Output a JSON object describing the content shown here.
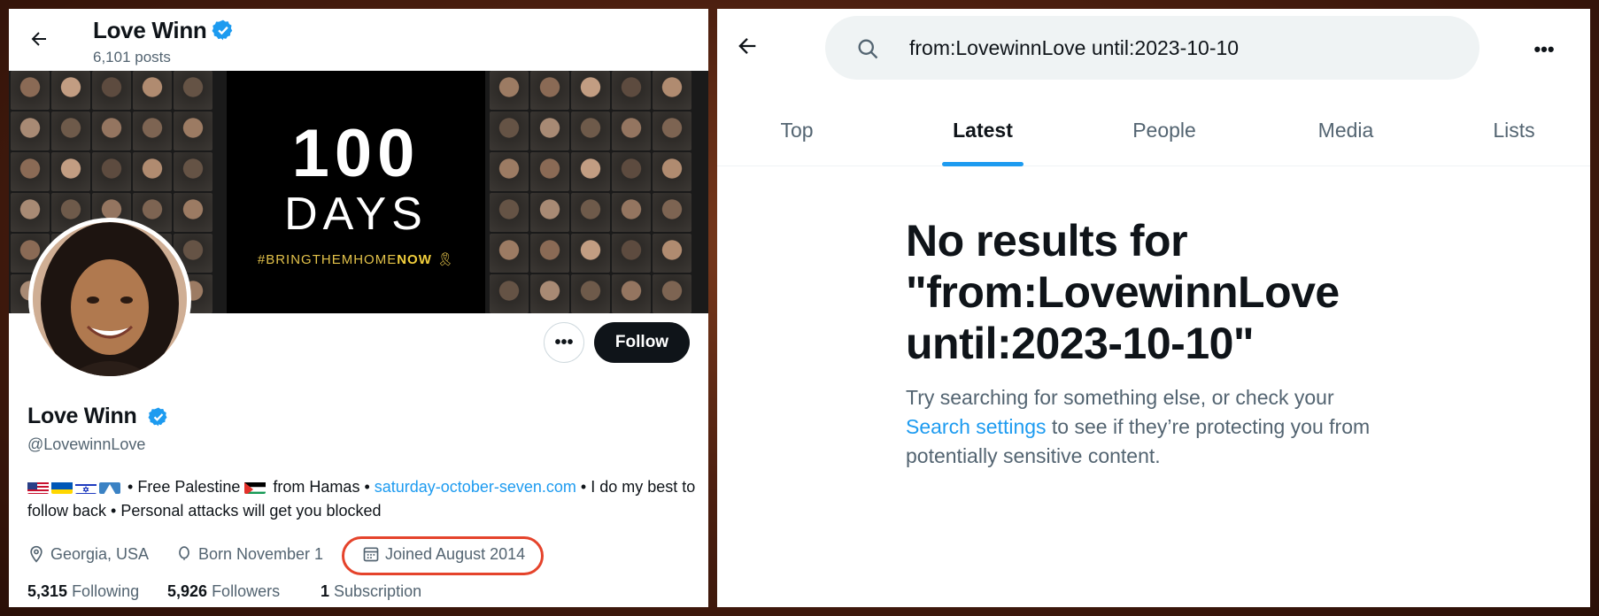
{
  "left": {
    "header": {
      "name": "Love Winn",
      "posts": "6,101 posts"
    },
    "banner": {
      "big_number": "100",
      "word": "DAYS",
      "hashtag_prefix": "#BRINGTHEMHOME",
      "hashtag_suffix": "NOW",
      "ribbon": "🎗"
    },
    "actions": {
      "more": "•••",
      "follow": "Follow"
    },
    "profile": {
      "display_name": "Love Winn",
      "handle": "@LovewinnLove",
      "bio_part1": "• Free Palestine",
      "bio_part2": "from Hamas •",
      "bio_link": "saturday-october-seven.com",
      "bio_part3": "• I do my best to follow back • Personal attacks will get you blocked"
    },
    "meta": {
      "location": "Georgia, USA",
      "born": "Born November 1",
      "joined": "Joined August 2014"
    },
    "stats": {
      "following_count": "5,315",
      "following_label": "Following",
      "followers_count": "5,926",
      "followers_label": "Followers",
      "subscription_count": "1",
      "subscription_label": "Subscription"
    }
  },
  "right": {
    "search": {
      "query": "from:LovewinnLove until:2023-10-10"
    },
    "more": "•••",
    "tabs": [
      {
        "label": "Top"
      },
      {
        "label": "Latest"
      },
      {
        "label": "People"
      },
      {
        "label": "Media"
      },
      {
        "label": "Lists"
      }
    ],
    "active_tab": "Latest",
    "empty_state": {
      "title": "No results for \"from:LovewinnLove until:2023-10-10\"",
      "body_before": "Try searching for something else, or check your ",
      "body_link": "Search settings",
      "body_after": " to see if they’re protecting you from potentially sensitive content."
    }
  },
  "colors": {
    "accent": "#1d9bf0",
    "text": "#0f1419",
    "muted": "#536471",
    "highlight": "#e5432b"
  }
}
